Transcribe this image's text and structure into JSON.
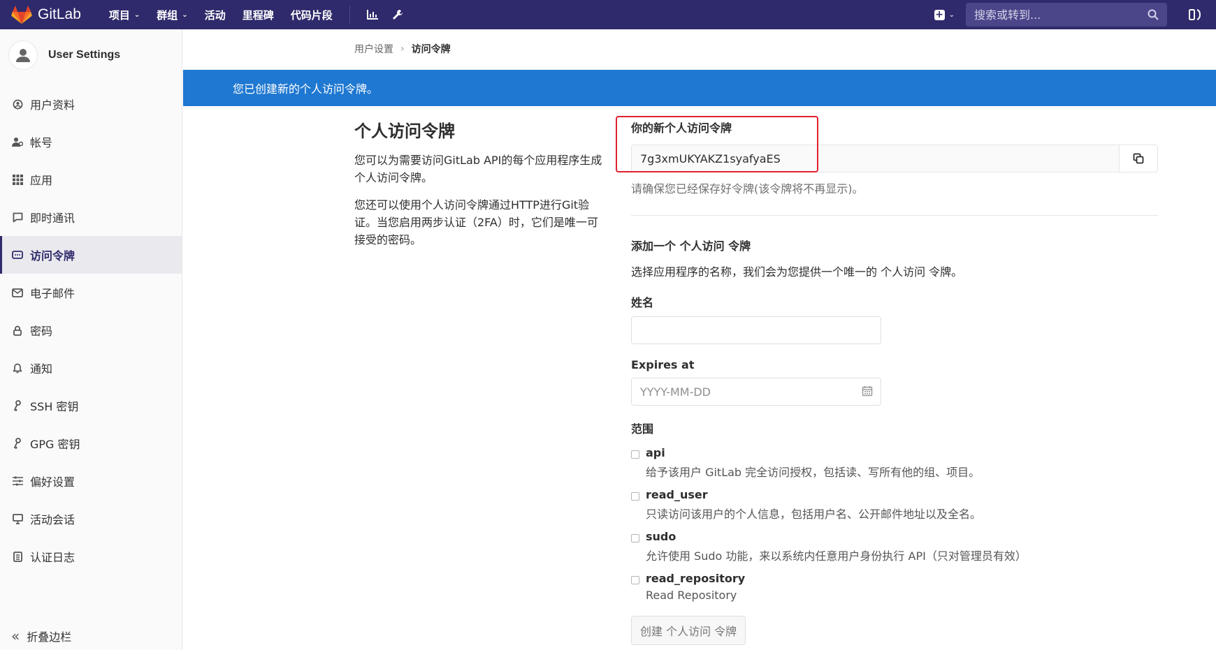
{
  "navbar": {
    "brand": "GitLab",
    "items": [
      {
        "label": "项目",
        "dropdown": true
      },
      {
        "label": "群组",
        "dropdown": true
      },
      {
        "label": "活动",
        "dropdown": false
      },
      {
        "label": "里程碑",
        "dropdown": false
      },
      {
        "label": "代码片段",
        "dropdown": false
      }
    ],
    "search_placeholder": "搜索或转到...",
    "accent_color": "#2f2a6b"
  },
  "sidebar": {
    "title": "User Settings",
    "items": [
      {
        "label": "用户资料",
        "icon": "profile-icon"
      },
      {
        "label": "帐号",
        "icon": "account-icon"
      },
      {
        "label": "应用",
        "icon": "applications-icon"
      },
      {
        "label": "即时通讯",
        "icon": "chat-icon"
      },
      {
        "label": "访问令牌",
        "icon": "token-icon",
        "active": true
      },
      {
        "label": "电子邮件",
        "icon": "mail-icon"
      },
      {
        "label": "密码",
        "icon": "lock-icon"
      },
      {
        "label": "通知",
        "icon": "bell-icon"
      },
      {
        "label": "SSH 密钥",
        "icon": "key-icon"
      },
      {
        "label": "GPG 密钥",
        "icon": "key-icon"
      },
      {
        "label": "偏好设置",
        "icon": "preferences-icon"
      },
      {
        "label": "活动会话",
        "icon": "monitor-icon"
      },
      {
        "label": "认证日志",
        "icon": "log-icon"
      }
    ],
    "collapse_label": "折叠边栏"
  },
  "breadcrumb": {
    "parent": "用户设置",
    "current": "访问令牌"
  },
  "flash": {
    "message": "您已创建新的个人访问令牌。",
    "color": "#1f78d1"
  },
  "intro": {
    "title": "个人访问令牌",
    "paragraph1": "您可以为需要访问GitLab API的每个应用程序生成个人访问令牌。",
    "paragraph2": "您还可以使用个人访问令牌通过HTTP进行Git验证。当您启用两步认证（2FA）时，它们是唯一可接受的密码。"
  },
  "new_token": {
    "label": "你的新个人访问令牌",
    "value": "7g3xmUKYAKZ1syafyaES",
    "help": "请确保您已经保存好令牌(该令牌将不再显示)。"
  },
  "form": {
    "title": "添加一个 个人访问 令牌",
    "description": "选择应用程序的名称，我们会为您提供一个唯一的 个人访问 令牌。",
    "name_label": "姓名",
    "name_value": "",
    "expires_label": "Expires at",
    "expires_placeholder": "YYYY-MM-DD",
    "scopes_label": "范围",
    "scopes": [
      {
        "name": "api",
        "description": "给予该用户 GitLab 完全访问授权，包括读、写所有他的组、项目。",
        "checked": false
      },
      {
        "name": "read_user",
        "description": "只读访问该用户的个人信息，包括用户名、公开邮件地址以及全名。",
        "checked": false
      },
      {
        "name": "sudo",
        "description": "允许使用 Sudo 功能，来以系统内任意用户身份执行 API（只对管理员有效）",
        "checked": false
      },
      {
        "name": "read_repository",
        "description": "Read Repository",
        "checked": false
      }
    ],
    "submit_label": "创建 个人访问 令牌"
  }
}
